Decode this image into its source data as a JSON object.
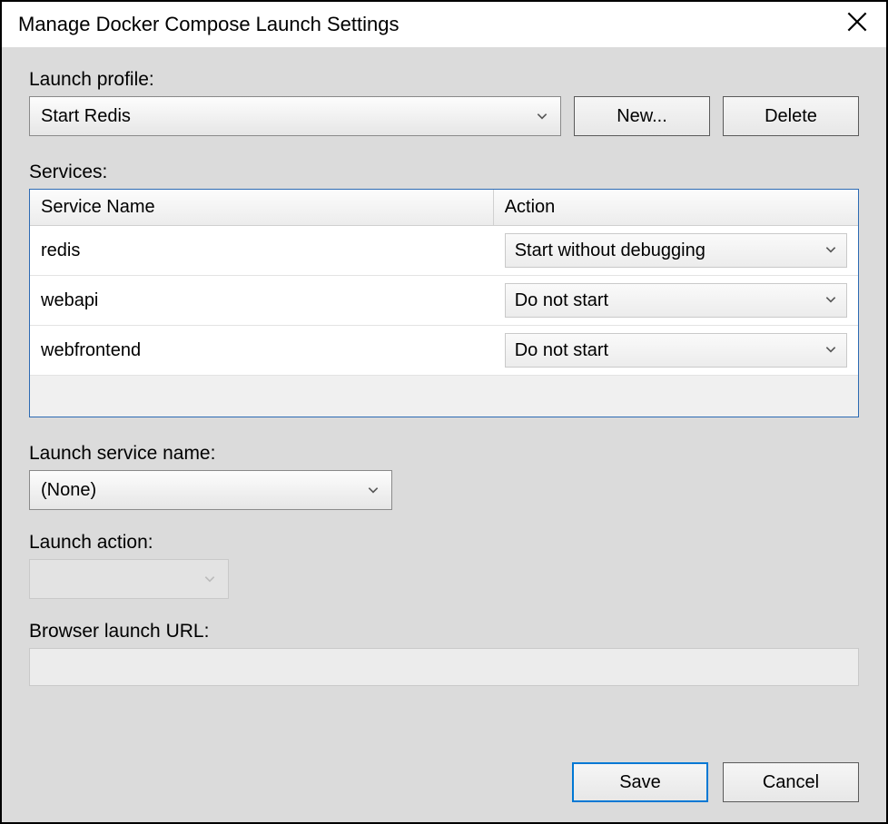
{
  "title": "Manage Docker Compose Launch Settings",
  "labels": {
    "launch_profile": "Launch profile:",
    "services": "Services:",
    "launch_service_name": "Launch service name:",
    "launch_action": "Launch action:",
    "browser_launch_url": "Browser launch URL:"
  },
  "profile": {
    "selected": "Start Redis",
    "new_button": "New...",
    "delete_button": "Delete"
  },
  "services_table": {
    "headers": {
      "name": "Service Name",
      "action": "Action"
    },
    "rows": [
      {
        "name": "redis",
        "action": "Start without debugging"
      },
      {
        "name": "webapi",
        "action": "Do not start"
      },
      {
        "name": "webfrontend",
        "action": "Do not start"
      }
    ]
  },
  "launch_service_name": {
    "selected": "(None)"
  },
  "launch_action": {
    "selected": ""
  },
  "browser_launch_url": {
    "value": ""
  },
  "footer": {
    "save": "Save",
    "cancel": "Cancel"
  }
}
